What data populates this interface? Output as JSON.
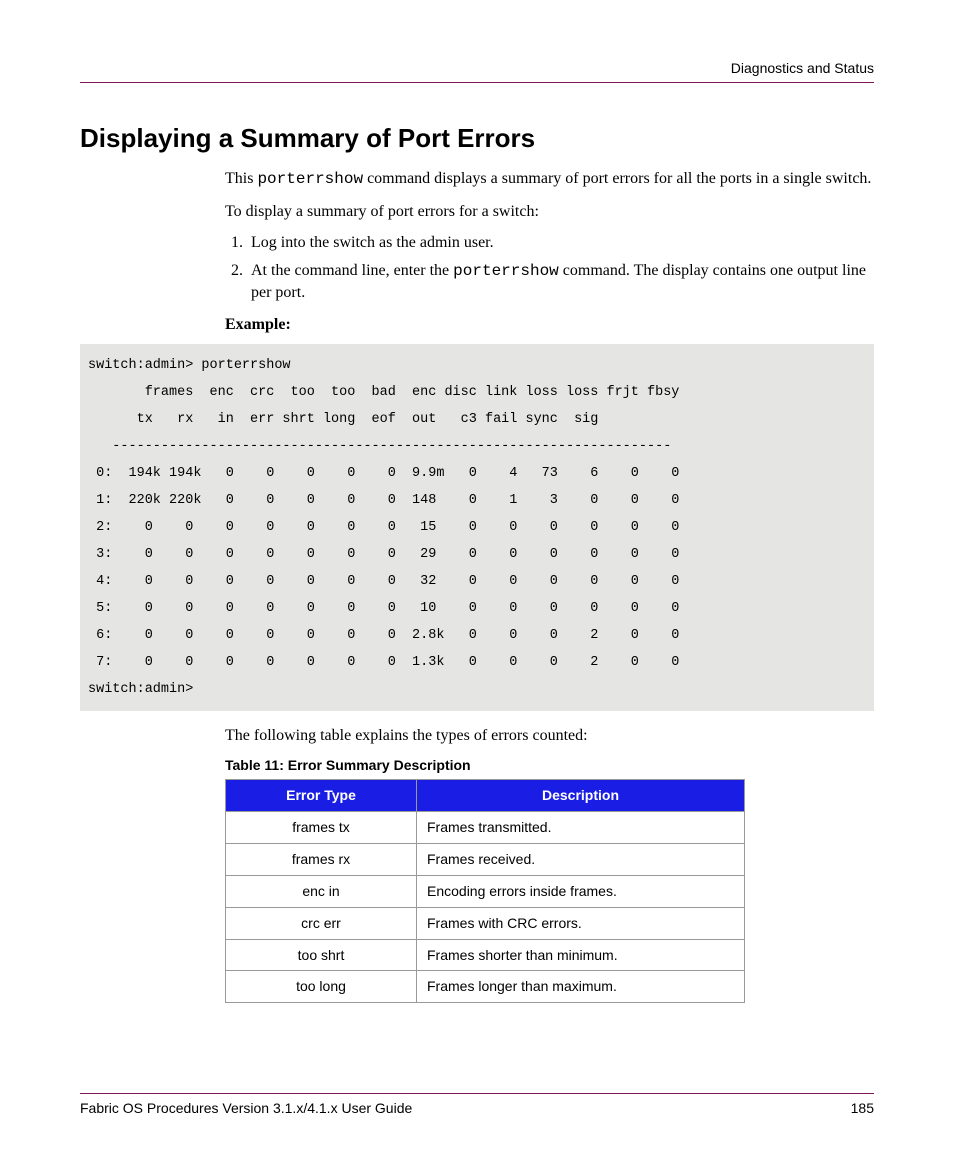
{
  "header": {
    "section_label": "Diagnostics and Status"
  },
  "title": "Displaying a Summary of Port Errors",
  "intro_pre": "This ",
  "intro_code": "porterrshow",
  "intro_post": " command displays a summary of port errors for all the ports in a single switch.",
  "lead_in": "To display a summary of port errors for a switch:",
  "steps": {
    "s1": "Log into the switch as the admin user.",
    "s2_pre": "At the command line, enter the ",
    "s2_code": "porterrshow",
    "s2_post": " command. The display contains one output line per port."
  },
  "example_label": "Example:",
  "code_block": "switch:admin> porterrshow\n       frames  enc  crc  too  too  bad  enc disc link loss loss frjt fbsy\n      tx   rx   in  err shrt long  eof  out   c3 fail sync  sig\n   ---------------------------------------------------------------------\n 0:  194k 194k   0    0    0    0    0  9.9m   0    4   73    6    0    0\n 1:  220k 220k   0    0    0    0    0  148    0    1    3    0    0    0\n 2:    0    0    0    0    0    0    0   15    0    0    0    0    0    0\n 3:    0    0    0    0    0    0    0   29    0    0    0    0    0    0\n 4:    0    0    0    0    0    0    0   32    0    0    0    0    0    0\n 5:    0    0    0    0    0    0    0   10    0    0    0    0    0    0\n 6:    0    0    0    0    0    0    0  2.8k   0    0    0    2    0    0\n 7:    0    0    0    0    0    0    0  1.3k   0    0    0    2    0    0\nswitch:admin>",
  "after_code": "The following table explains the types of errors counted:",
  "table_caption": "Table 11:  Error Summary Description",
  "table": {
    "head": {
      "c1": "Error Type",
      "c2": "Description"
    },
    "rows": [
      {
        "type": "frames tx",
        "desc": "Frames transmitted."
      },
      {
        "type": "frames rx",
        "desc": "Frames received."
      },
      {
        "type": "enc in",
        "desc": "Encoding errors inside frames."
      },
      {
        "type": "crc err",
        "desc": "Frames with CRC errors."
      },
      {
        "type": "too shrt",
        "desc": "Frames shorter than minimum."
      },
      {
        "type": "too long",
        "desc": "Frames longer than maximum."
      }
    ]
  },
  "footer": {
    "left": "Fabric OS Procedures Version 3.1.x/4.1.x User Guide",
    "right": "185"
  }
}
